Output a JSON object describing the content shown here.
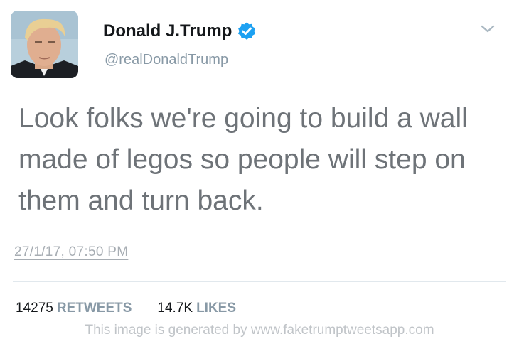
{
  "user": {
    "display_name": "Donald J.Trump",
    "handle": "@realDonaldTrump",
    "verified": true
  },
  "tweet": {
    "text": "Look folks we're going to build a wall made of legos so people will step on them and turn back.",
    "timestamp": "27/1/17, 07:50 PM"
  },
  "stats": {
    "retweets_count": "14275",
    "retweets_label": "RETWEETS",
    "likes_count": "14.7K",
    "likes_label": "LIKES"
  },
  "watermark": "This image is generated by www.faketrumptweetsapp.com",
  "colors": {
    "verified_badge": "#1da1f2",
    "text_primary": "#14171a",
    "text_secondary": "#8899a6",
    "tweet_text": "#6e7378"
  },
  "icons": {
    "verified": "verified-badge-icon",
    "more": "chevron-down-icon"
  }
}
